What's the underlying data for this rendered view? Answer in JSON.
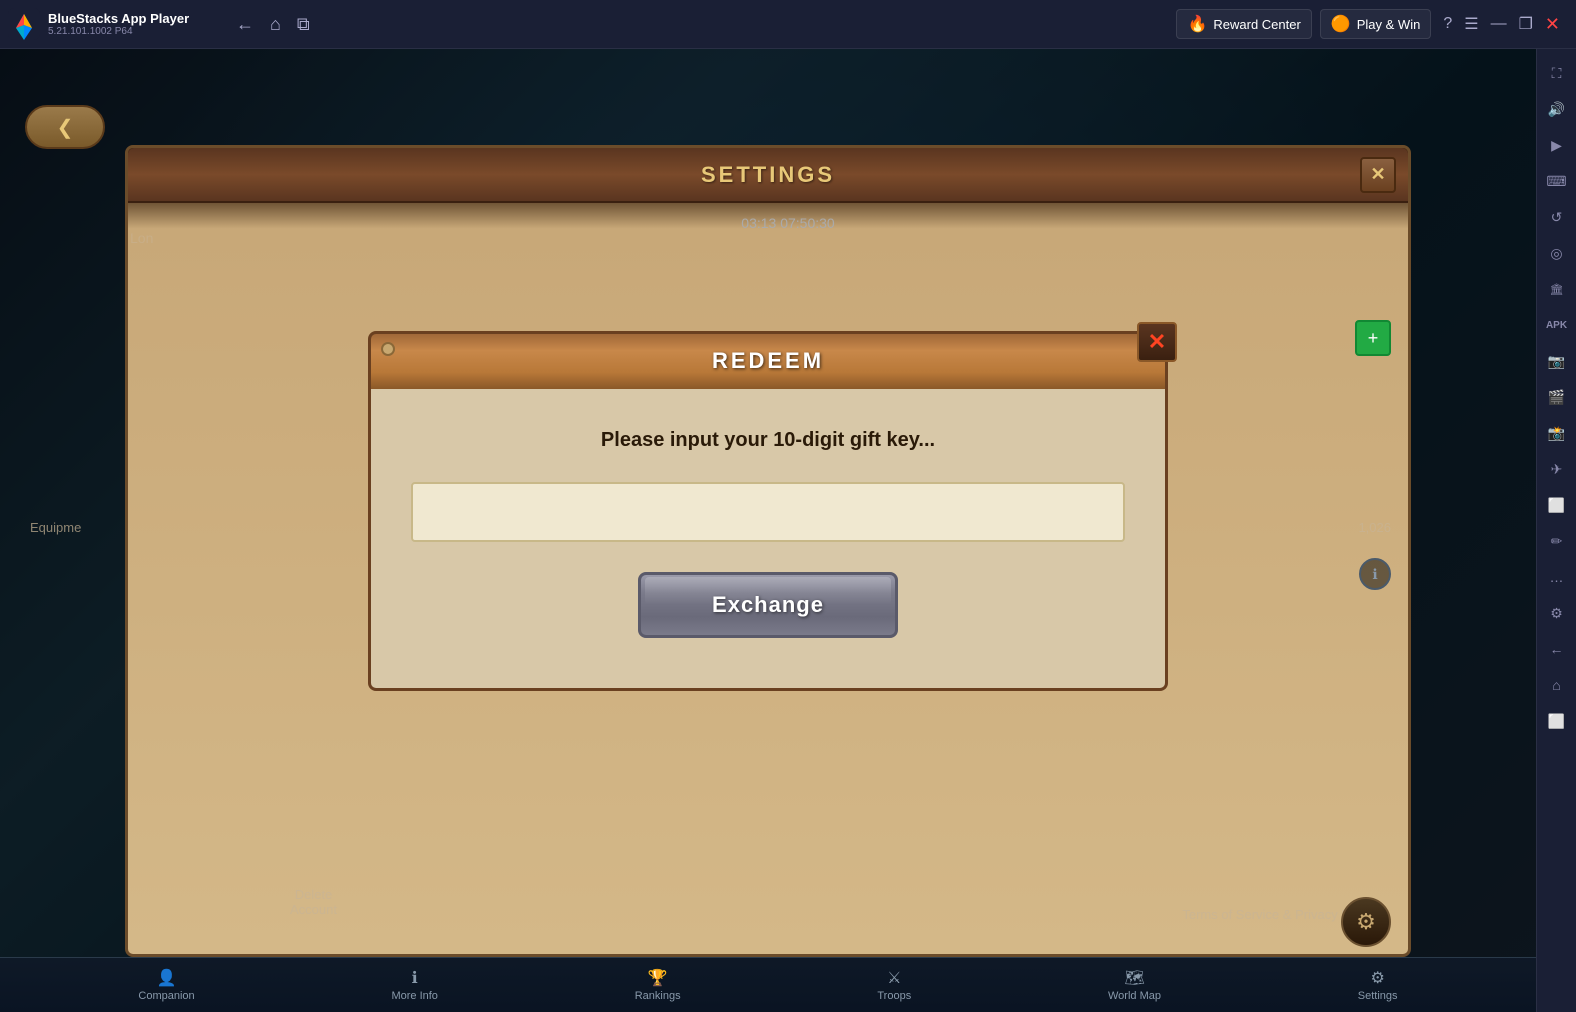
{
  "app": {
    "title": "BlueStacks App Player",
    "version": "5.21.101.1002  P64"
  },
  "topbar": {
    "back_label": "←",
    "home_label": "⌂",
    "tabs_label": "⧉",
    "reward_center_label": "Reward Center",
    "play_win_label": "Play & Win",
    "help_label": "?",
    "menu_label": "☰",
    "minimize_label": "—",
    "maximize_label": "❐",
    "close_label": "✕"
  },
  "settings": {
    "title": "SETTINGS",
    "timer": "03:13 07:50:30",
    "close_label": "✕"
  },
  "redeem": {
    "title": "REDEEM",
    "instruction": "Please input your 10-digit gift key...",
    "input_placeholder": "",
    "exchange_label": "Exchange",
    "close_label": "✕"
  },
  "game": {
    "back_label": "❮",
    "lon_text": "Lon",
    "equip_text": "Equipme",
    "number": "1,026",
    "zero": "0",
    "delete_account": "Delete\nAccount",
    "terms": "Terms of Service",
    "privacy": "Privacy Policy"
  },
  "bottom_nav": {
    "items": [
      {
        "label": "Companion"
      },
      {
        "label": "More Info"
      },
      {
        "label": "Rankings"
      },
      {
        "label": "Troops"
      },
      {
        "label": "World Map"
      },
      {
        "label": "Settings"
      }
    ]
  },
  "sidebar": {
    "icons": [
      "⛶",
      "🔊",
      "▶",
      "⌨",
      "↺",
      "◎",
      "🏛",
      "APK",
      "📷",
      "🎬",
      "📸",
      "✈",
      "⬜",
      "✏",
      "…",
      "⚙",
      "←",
      "⌂",
      "⬜"
    ]
  }
}
